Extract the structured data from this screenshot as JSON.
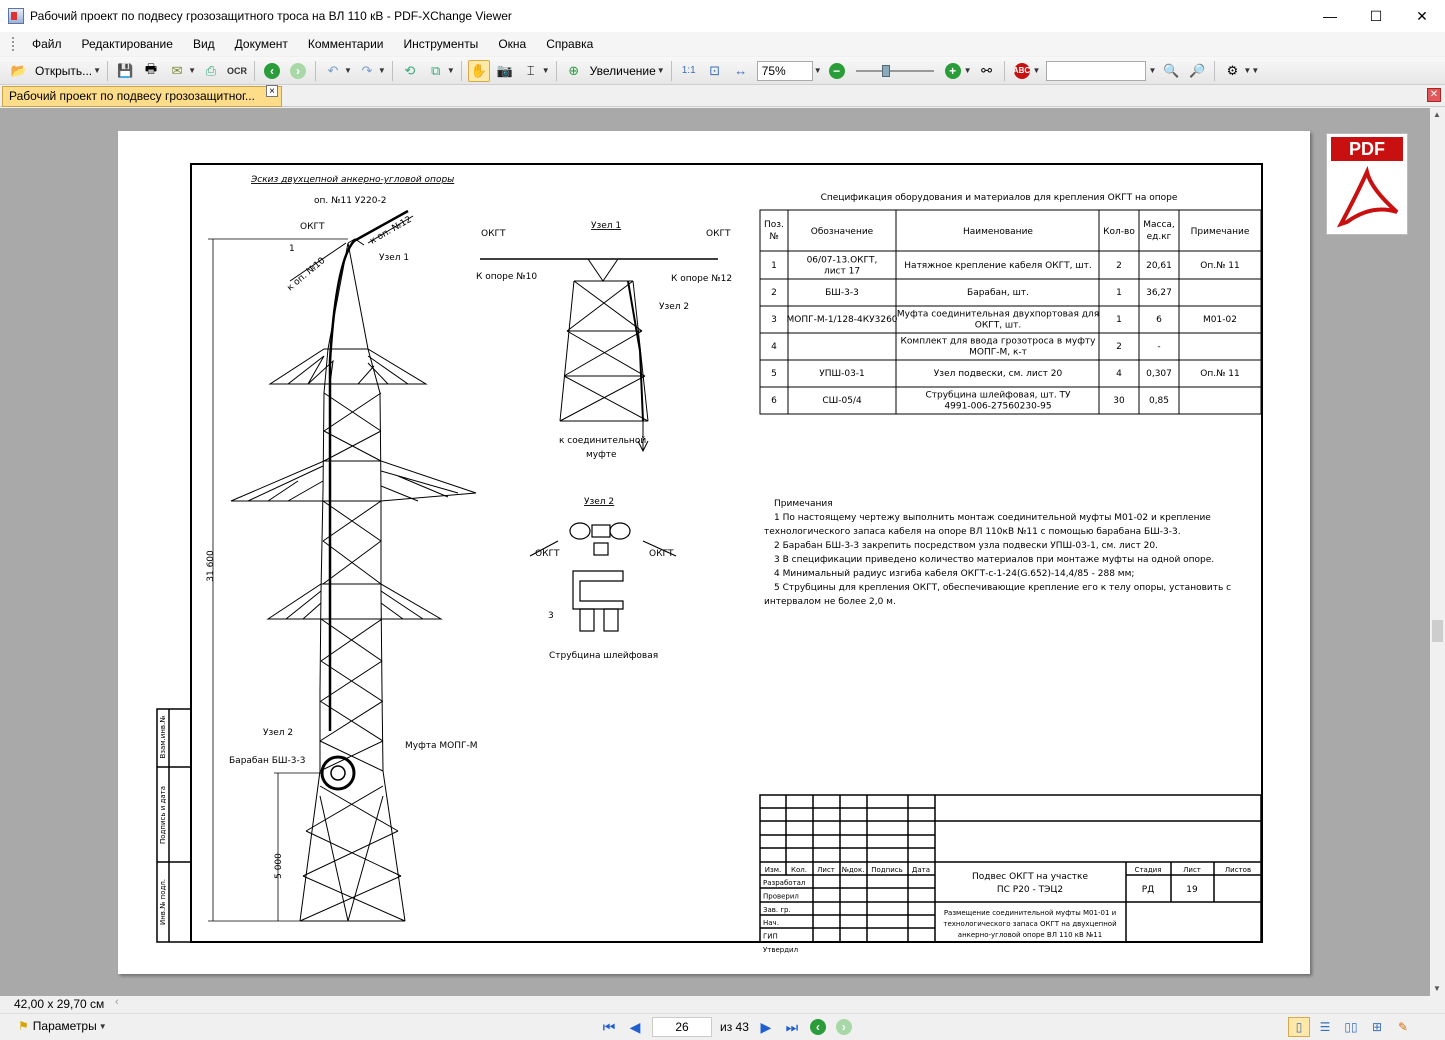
{
  "window": {
    "title": "Рабочий проект по подвесу грозозащитного троса на ВЛ 110 кВ - PDF-XChange Viewer",
    "minimize": "—",
    "maximize": "☐",
    "close": "✕"
  },
  "menu": [
    "Файл",
    "Редактирование",
    "Вид",
    "Документ",
    "Комментарии",
    "Инструменты",
    "Окна",
    "Справка"
  ],
  "toolbar": {
    "open_label": "Открыть...",
    "zoom_in_label": "Увеличение",
    "zoom_value": "75%",
    "ocr_label": "OCR"
  },
  "tab": {
    "label": "Рабочий проект по подвесу грозозащитног...",
    "close": "×"
  },
  "status": {
    "page_size": "42,00 x 29,70 см",
    "params_label": "Параметры",
    "current_page": "26",
    "page_total": "из 43"
  },
  "pdf_badge": "PDF",
  "drawing": {
    "sketch_title": "Эскиз двухцепной анкерно-угловой опоры",
    "sketch_sub": "оп. №11 У220-2",
    "labels": {
      "okgt": "ОКГТ",
      "n1": "1",
      "to12": "к оп. №12",
      "to10": "к оп. №10",
      "uzel1": "Узел 1",
      "uzel2": "Узел 2",
      "height": "31 600",
      "h5000": "5 000",
      "baraban": "Барабан БШ-3-3",
      "mufta": "Муфта МОПГ-М",
      "k_opore10": "К опоре №10",
      "k_opore12": "К опоре №12",
      "k_soed": "к соединительной",
      "mufte": "муфте",
      "n3": "3",
      "strubcina": "Струбцина шлейфовая"
    },
    "spec_title": "Спецификация оборудования и материалов для крепления ОКГТ на опоре",
    "spec_headers": [
      "Поз. №",
      "Обозначение",
      "Наименование",
      "Кол-во",
      "Масса, ед.кг",
      "Примечание"
    ],
    "spec_rows": [
      [
        "1",
        "06/07-13.ОКГТ, лист 17",
        "Натяжное крепление кабеля ОКГТ, шт.",
        "2",
        "20,61",
        "Оп.№ 11"
      ],
      [
        "2",
        "БШ-3-3",
        "Барабан, шт.",
        "1",
        "36,27",
        ""
      ],
      [
        "3",
        "МОПГ-М-1/128-4КУ3260",
        "Муфта соединительная двухпортовая для ОКГТ, шт.",
        "1",
        "6",
        "М01-02"
      ],
      [
        "4",
        "",
        "Комплект для ввода грозотроса в муфту МОПГ-М, к-т",
        "2",
        "-",
        ""
      ],
      [
        "5",
        "УПШ-03-1",
        "Узел подвески, см. лист 20",
        "4",
        "0,307",
        "Оп.№ 11"
      ],
      [
        "6",
        "СШ-05/4",
        "Струбцина шлейфовая, шт. ТУ 4991-006-27560230-95",
        "30",
        "0,85",
        ""
      ]
    ],
    "notes_title": "Примечания",
    "notes": [
      "1  По  настоящему  чертежу  выполнить  монтаж  соединительной  муфты  М01-02  и  крепление",
      "технологического запаса кабеля на опоре ВЛ 110кВ №11 с помощью барабана БШ-3-3.",
      "2  Барабан БШ-3-3 закрепить посредством узла подвески УПШ-03-1, см. лист 20.",
      "3 В спецификации приведено количество материалов при монтаже муфты на одной опоре.",
      "4  Минимальный радиус изгиба кабеля ОКГТ-с-1-24(G.652)-14,4/85 - 288 мм;",
      "5  Струбцины для крепления ОКГТ, обеспечивающие крепление его к телу опоры, установить с",
      "интервалом не более 2,0 м."
    ],
    "stamp": {
      "cols": [
        "Изм.",
        "Кол.",
        "Лист",
        "№док.",
        "Подпись",
        "Дата"
      ],
      "roles": [
        "Разработал",
        "Проверил",
        "Зав. гр.",
        "Нач.",
        "ГИП",
        "Утвердил"
      ],
      "title1": "Подвес ОКГТ на участке",
      "title2": "ПС Р20 - ТЭЦ2",
      "stage_h": "Стадия",
      "sheet_h": "Лист",
      "sheets_h": "Листов",
      "stage": "РД",
      "sheet": "19",
      "desc1": "Размещение соединительной муфты М01-01 и",
      "desc2": "технологического запаса ОКГТ на двухцепной",
      "desc3": "анкерно-угловой опоре ВЛ 110 кВ №11"
    },
    "side_stamp": [
      "Взам.инв.№",
      "Подпись и дата",
      "Инв.№ подл."
    ]
  }
}
